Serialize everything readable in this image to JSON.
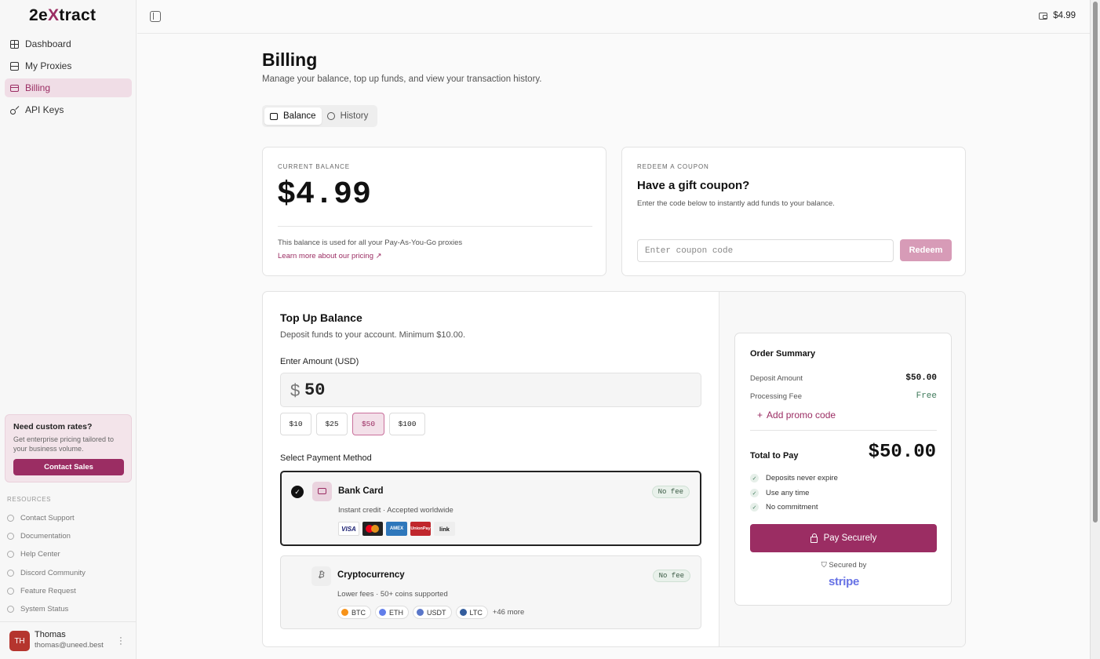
{
  "app": {
    "logo_pre": "2e",
    "logo_x": "X",
    "logo_post": "tract"
  },
  "sidebar": {
    "items": [
      {
        "label": "Dashboard",
        "icon": "grid-icon"
      },
      {
        "label": "My Proxies",
        "icon": "server-icon"
      },
      {
        "label": "Billing",
        "icon": "card-icon",
        "active": true
      },
      {
        "label": "API Keys",
        "icon": "key-icon"
      }
    ],
    "promo": {
      "title": "Need custom rates?",
      "text": "Get enterprise pricing tailored to your business volume.",
      "button": "Contact Sales"
    },
    "resources_title": "RESOURCES",
    "resources": [
      "Contact Support",
      "Documentation",
      "Help Center",
      "Discord Community",
      "Feature Request",
      "System Status"
    ],
    "user": {
      "initials": "TH",
      "name": "Thomas",
      "email": "thomas@uneed.best"
    }
  },
  "topbar": {
    "balance": "$4.99"
  },
  "page": {
    "title": "Billing",
    "subtitle": "Manage your balance, top up funds, and view your transaction history.",
    "tabs": [
      "Balance",
      "History"
    ]
  },
  "balance_card": {
    "kicker": "CURRENT BALANCE",
    "amount": "$4.99",
    "note": "This balance is used for all your Pay-As-You-Go proxies",
    "link": "Learn more about our pricing ↗"
  },
  "coupon_card": {
    "kicker": "REDEEM A COUPON",
    "title": "Have a gift coupon?",
    "text": "Enter the code below to instantly add funds to your balance.",
    "placeholder": "Enter coupon code",
    "button": "Redeem"
  },
  "topup": {
    "title": "Top Up Balance",
    "subtitle": "Deposit funds to your account. Minimum $10.00.",
    "amount_label": "Enter Amount (USD)",
    "currency": "$",
    "amount": "50",
    "presets": [
      "$10",
      "$25",
      "$50",
      "$100"
    ],
    "selected_preset": "$50",
    "method_label": "Select Payment Method",
    "methods": [
      {
        "title": "Bank Card",
        "subtitle": "Instant credit · Accepted worldwide",
        "badge": "No fee",
        "brands": [
          "VISA",
          "Mastercard",
          "AMEX",
          "UnionPay",
          "link"
        ]
      },
      {
        "title": "Cryptocurrency",
        "subtitle": "Lower fees · 50+ coins supported",
        "badge": "No fee",
        "coins": [
          "BTC",
          "ETH",
          "USDT",
          "LTC"
        ],
        "more": "+46 more"
      }
    ]
  },
  "summary": {
    "title": "Order Summary",
    "deposit_label": "Deposit Amount",
    "deposit_value": "$50.00",
    "fee_label": "Processing Fee",
    "fee_value": "Free",
    "promo": "Add promo code",
    "total_label": "Total to Pay",
    "total_value": "$50.00",
    "benefits": [
      "Deposits never expire",
      "Use any time",
      "No commitment"
    ],
    "pay_button": "Pay Securely",
    "secured": "Secured by",
    "stripe": "stripe"
  },
  "colors": {
    "accent": "#9b2d63",
    "accent_light": "#f0dde6",
    "success": "#3f7a5b"
  }
}
